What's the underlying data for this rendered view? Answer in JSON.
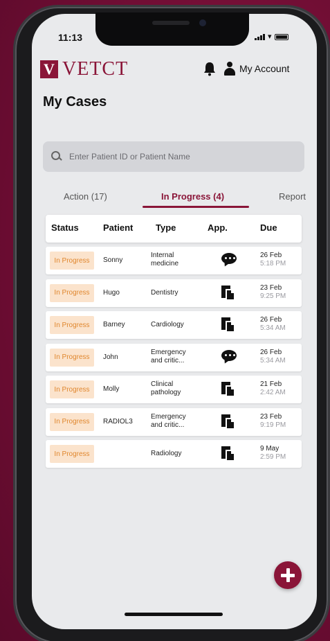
{
  "status_bar": {
    "time": "11:13"
  },
  "brand": {
    "logo_mark": "V",
    "logo_text": "VETCT"
  },
  "header": {
    "account_label": "My Account",
    "bell_icon": "bell-icon",
    "account_icon": "user-icon"
  },
  "page": {
    "title": "My Cases"
  },
  "search": {
    "placeholder": "Enter Patient ID or Patient Name"
  },
  "tabs": [
    {
      "label": "Action (17)",
      "active": false
    },
    {
      "label": "In Progress (4)",
      "active": true
    },
    {
      "label": "Report",
      "active": false
    }
  ],
  "table": {
    "headers": [
      "Status",
      "Patient",
      "Type",
      "App.",
      "Due"
    ],
    "rows": [
      {
        "status": "In Progress",
        "patient": "Sonny",
        "type": "Internal medicine",
        "app": "chat-icon",
        "due_date": "26 Feb",
        "due_time": "5:18 PM"
      },
      {
        "status": "In Progress",
        "patient": "Hugo",
        "type": "Dentistry",
        "app": "document-icon",
        "due_date": "23 Feb",
        "due_time": "9:25 PM"
      },
      {
        "status": "In Progress",
        "patient": "Barney",
        "type": "Cardiology",
        "app": "document-icon",
        "due_date": "26 Feb",
        "due_time": "5:34 AM"
      },
      {
        "status": "In Progress",
        "patient": "John",
        "type": "Emergency and critic...",
        "app": "chat-icon",
        "due_date": "26 Feb",
        "due_time": "5:34 AM"
      },
      {
        "status": "In Progress",
        "patient": "Molly",
        "type": "Clinical pathology",
        "app": "document-icon",
        "due_date": "21 Feb",
        "due_time": "2:42 AM"
      },
      {
        "status": "In Progress",
        "patient": "RADIOL3",
        "type": "Emergency and critic...",
        "app": "document-icon",
        "due_date": "23 Feb",
        "due_time": "9:19 PM"
      },
      {
        "status": "In Progress",
        "patient": "",
        "type": "Radiology",
        "app": "document-icon",
        "due_date": "9 May",
        "due_time": "2:59 PM"
      }
    ]
  },
  "fab": {
    "icon": "plus-icon"
  },
  "colors": {
    "brand": "#8a1538",
    "badge_bg": "#fbe3cc",
    "badge_text": "#e0872e",
    "background": "#7a1038"
  }
}
